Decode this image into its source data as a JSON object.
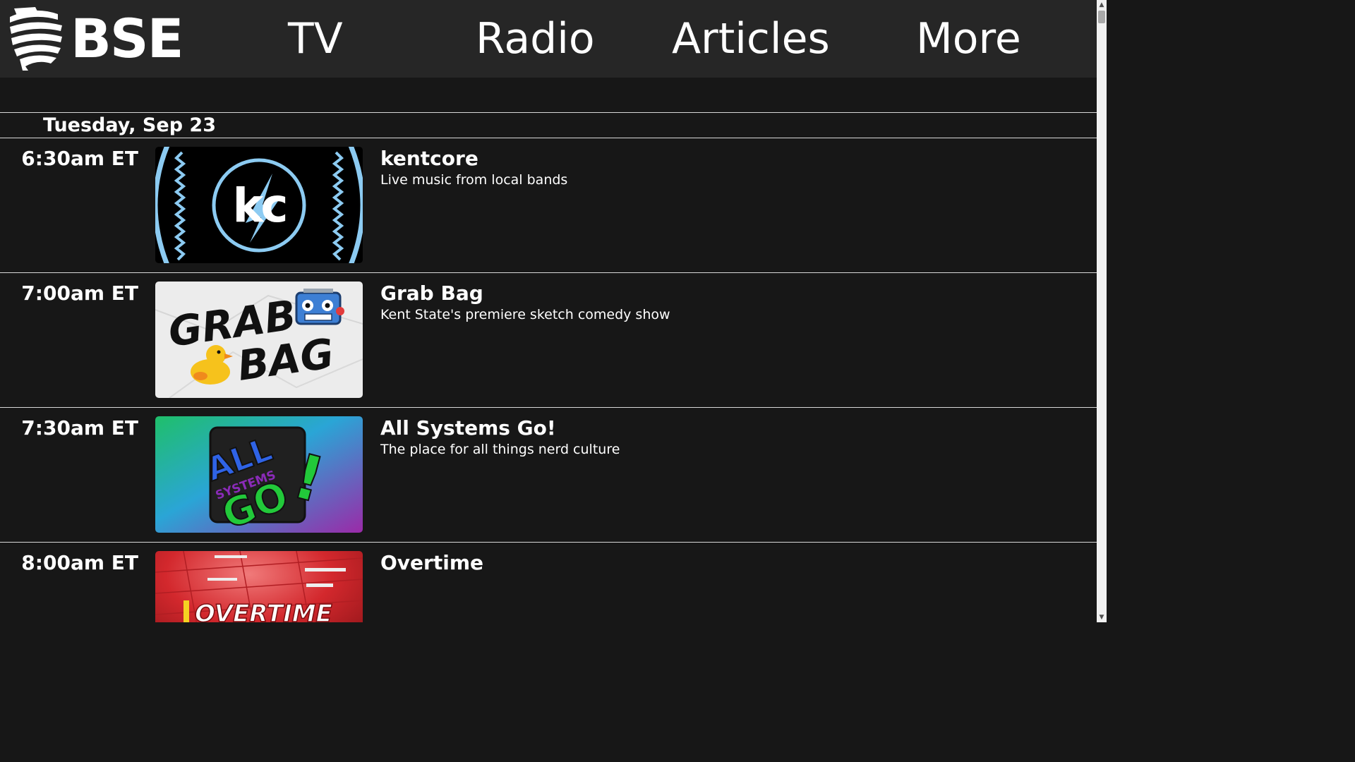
{
  "header": {
    "logo_text": "BSE",
    "nav": [
      {
        "label": "TV"
      },
      {
        "label": "Radio"
      },
      {
        "label": "Articles"
      },
      {
        "label": "More"
      }
    ]
  },
  "schedule": {
    "day_heading": "Tuesday, Sep 23",
    "shows": [
      {
        "time": "6:30am ET",
        "title": "kentcore",
        "description": "Live music from local bands",
        "thumb_text": "kc"
      },
      {
        "time": "7:00am ET",
        "title": "Grab Bag",
        "description": "Kent State's premiere sketch comedy show",
        "thumb_text_1": "GRAB",
        "thumb_text_2": "BAG"
      },
      {
        "time": "7:30am ET",
        "title": "All Systems Go!",
        "description": "The place for all things nerd culture",
        "thumb_text_1": "ALL",
        "thumb_text_2": "SYSTEMS",
        "thumb_text_3": "GO",
        "thumb_text_4": "!"
      },
      {
        "time": "8:00am ET",
        "title": "Overtime",
        "description": "",
        "thumb_text": "OVERTIME"
      }
    ]
  },
  "colors": {
    "background": "#171717",
    "header": "#262626",
    "kentcore_accent": "#8ccbf2",
    "ags_green": "#22c93a",
    "ags_blue": "#2f63e6",
    "ags_purple": "#8a2bb8",
    "overtime_red": "#c9252b"
  }
}
